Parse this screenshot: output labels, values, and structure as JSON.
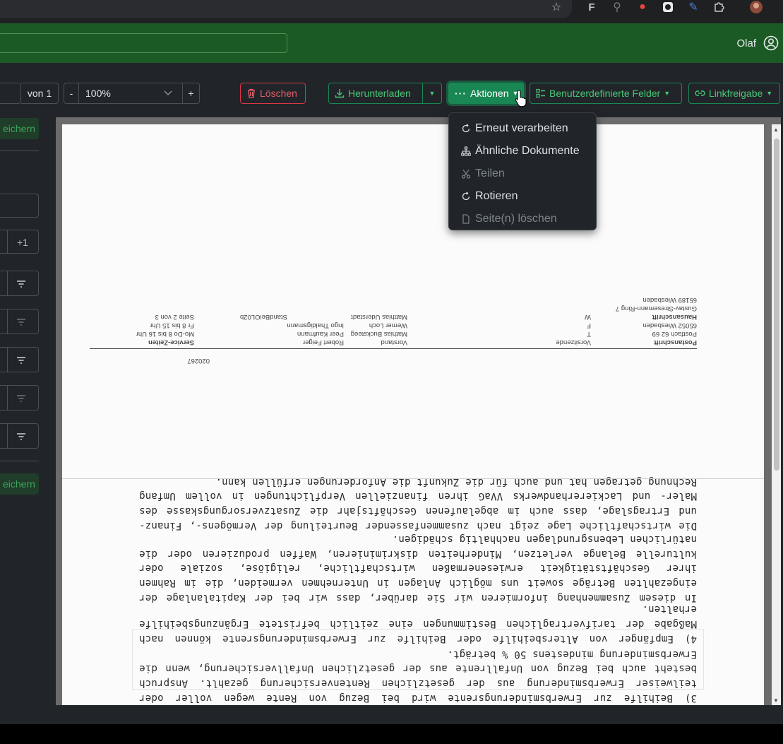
{
  "header": {
    "user_name": "Olaf"
  },
  "toolbar": {
    "page_of": "von 1",
    "zoom_minus": "-",
    "zoom_value": "100%",
    "zoom_plus": "+",
    "delete_label": "Löschen",
    "download_label": "Herunterladen",
    "actions_label": "Aktionen",
    "custom_fields_label": "Benutzerdefinierte Felder",
    "share_link_label": "Linkfreigabe"
  },
  "sidebar": {
    "save_label_top": "eichern",
    "save_label_bottom": "eichern",
    "plus_one": "+1"
  },
  "actions_menu": {
    "items": [
      {
        "label": "Erneut verarbeiten",
        "icon": "arrow-repeat-icon",
        "enabled": true
      },
      {
        "label": "Ähnliche Dokumente",
        "icon": "diagram-icon",
        "enabled": true
      },
      {
        "label": "Teilen",
        "icon": "scissors-icon",
        "enabled": false
      },
      {
        "label": "Rotieren",
        "icon": "arrow-clockwise-icon",
        "enabled": true
      },
      {
        "label": "Seite(n) löschen",
        "icon": "file-icon",
        "enabled": false
      }
    ]
  },
  "document": {
    "para_3": "3) Beihilfe zur Erwerbsminderungsrente wird bei Bezug von Rente wegen voller oder teilweiser Erwerbsminderung aus der gesetzlichen Rentenversicherung gezahlt. Anspruch besteht auch bei Bezug von Unfallrente aus der gesetzlichen Unfallversicherung, wenn die Erwerbsminderung mindestens 50 % beträgt.",
    "para_4": "4) Empfänger von Altersbeihilfe oder Beihilfe zur Erwerbsminderungsrente können nach Maßgabe der tarifvertraglichen Bestimmungen eine zeitlich befristete Ergänzungsbeihilfe erhalten.",
    "para_a": "In diesem Zusammenhang informieren wir Sie darüber, dass wir bei der Kapitalanlage der eingezahlten Beträge soweit uns möglich Anlagen in Unternehmen vermeiden, die im Rahmen ihrer Geschäftstätigkeit erwiesenermaßen wirtschaftliche, religiöse, soziale oder kulturelle Belange verletzen, Minderheiten diskriminieren, Waffen produzieren oder die natürlichen Lebensgrundlagen nachhaltig schädigen.",
    "para_b": "Die wirtschaftliche Lage zeigt nach zusammenfassender Beurteilung der Vermögens-, Finanz- und Ertragslage, dass auch im abgelaufenen Geschäftsjahr die Zusatzversorgungskasse des Maler- und Lackiererhandwerks VVaG ihren finanziellen Verpflichtungen in vollem Umfang Rechnung getragen hat und auch für die Zukunft die Anforderungen erfüllen kann.",
    "doc_number": "020267",
    "footer": {
      "col1": [
        "Postanschrift",
        "Postfach 62 69",
        "65052 Wiesbaden",
        "Hausanschrift",
        "Gustav-Stresemann-Ring 7",
        "65189 Wiesbaden"
      ],
      "col2": [
        "Vorsitzende",
        "T",
        "F",
        "W"
      ],
      "col3": [
        "Vorstand",
        "Mathias Bucksteeg",
        "Werner Loch",
        "Matthias Uderstadt"
      ],
      "col4": [
        "",
        "Robert Feiger",
        "Peer Kaufmann",
        "Ingo Thaldigsmann"
      ],
      "col5": [
        "",
        "",
        "",
        "StandBeiOL02b"
      ],
      "col6": [
        "Service-Zeiten",
        "Mo-Do 8 bis 16 Uhr",
        "Fr 8 bis 15 Uhr",
        "",
        "Seite 2 von 3"
      ]
    }
  }
}
